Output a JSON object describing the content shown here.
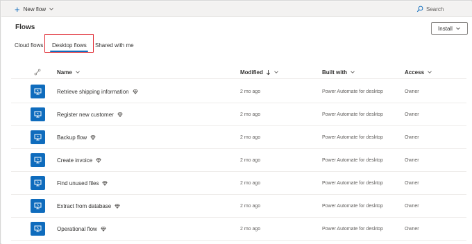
{
  "toolbar": {
    "new_flow_label": "New flow",
    "search_label": "Search"
  },
  "page": {
    "title": "Flows",
    "install_label": "Install"
  },
  "tabs": [
    {
      "label": "Cloud flows"
    },
    {
      "label": "Desktop flows",
      "selected": true
    },
    {
      "label": "Shared with me"
    }
  ],
  "table": {
    "columns": {
      "name": "Name",
      "modified": "Modified",
      "built_with": "Built with",
      "access": "Access"
    },
    "rows": [
      {
        "name": "Retrieve shipping information",
        "modified": "2 mo ago",
        "built_with": "Power Automate for desktop",
        "access": "Owner"
      },
      {
        "name": "Register new customer",
        "modified": "2 mo ago",
        "built_with": "Power Automate for desktop",
        "access": "Owner"
      },
      {
        "name": "Backup flow",
        "modified": "2 mo ago",
        "built_with": "Power Automate for desktop",
        "access": "Owner"
      },
      {
        "name": "Create invoice",
        "modified": "2 mo ago",
        "built_with": "Power Automate for desktop",
        "access": "Owner"
      },
      {
        "name": "Find unused files",
        "modified": "2 mo ago",
        "built_with": "Power Automate for desktop",
        "access": "Owner"
      },
      {
        "name": "Extract from database",
        "modified": "2 mo ago",
        "built_with": "Power Automate for desktop",
        "access": "Owner"
      },
      {
        "name": "Operational flow",
        "modified": "2 mo ago",
        "built_with": "Power Automate for desktop",
        "access": "Owner"
      }
    ]
  },
  "icons": {
    "new_flow": "plus-icon",
    "search": "search-icon",
    "flow_type": "desktop-flow-icon",
    "premium": "premium-diamond-icon",
    "column_type": "flow-type-column-icon"
  },
  "colors": {
    "accent": "#0f6cbd",
    "highlight_box": "#e0262f"
  }
}
